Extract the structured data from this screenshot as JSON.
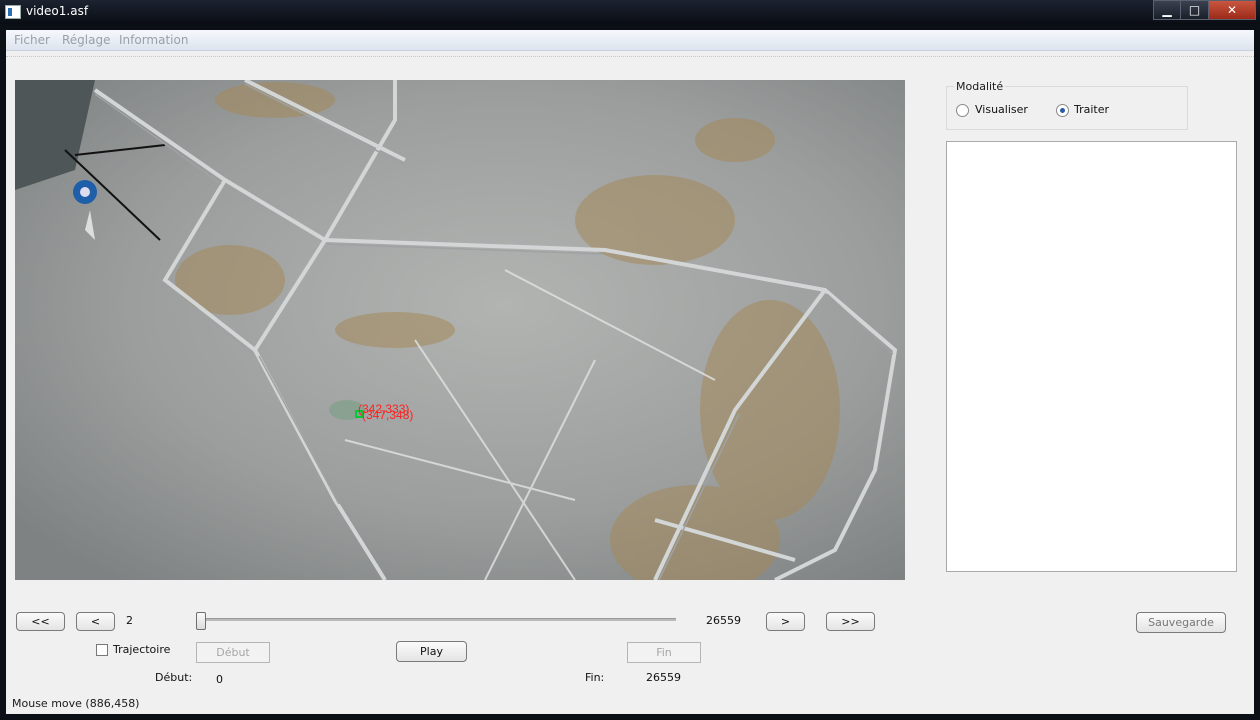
{
  "window": {
    "title": "video1.asf",
    "controls": {
      "minimize": "▁",
      "maximize": "□",
      "close": "✕"
    }
  },
  "menu": [
    "Ficher",
    "Réglage",
    "Information"
  ],
  "video": {
    "overlay_label_top": "(342,333)",
    "overlay_label_bottom": "(347,348)",
    "marker_color": "#00cc33",
    "label_color": "#ff2020"
  },
  "modalite": {
    "title": "Modalité",
    "options": [
      {
        "label": "Visualiser",
        "selected": false
      },
      {
        "label": "Traiter",
        "selected": true
      }
    ]
  },
  "controls": {
    "first": "<<",
    "prev": "<",
    "frame": "2",
    "total": "26559",
    "next": ">",
    "last": ">>",
    "save": "Sauvegarde",
    "trajectoire": "Trajectoire",
    "trajectoire_checked": false,
    "debut_button": "Début",
    "play": "Play",
    "fin_button": "Fin",
    "slider_position": 0.0,
    "debut_label": "Début:",
    "debut_value": "0",
    "fin_label": "Fin:",
    "fin_value": "26559"
  },
  "status": "Mouse move (886,458)"
}
